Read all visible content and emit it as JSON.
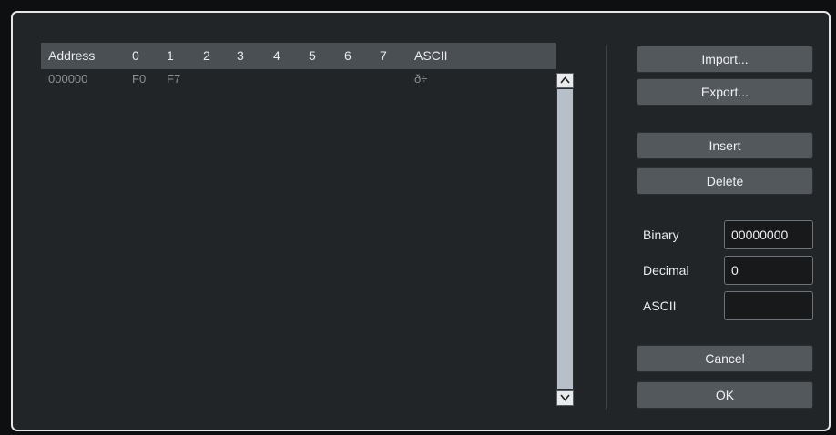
{
  "hex_table": {
    "columns": [
      "Address",
      "0",
      "1",
      "2",
      "3",
      "4",
      "5",
      "6",
      "7",
      "ASCII"
    ],
    "rows": [
      {
        "address": "000000",
        "bytes": [
          "F0",
          "F7",
          "",
          "",
          "",
          "",
          "",
          ""
        ],
        "ascii": "ð÷"
      }
    ]
  },
  "buttons": {
    "import": "Import...",
    "export": "Export...",
    "insert": "Insert",
    "delete": "Delete",
    "cancel": "Cancel",
    "ok": "OK"
  },
  "fields": {
    "binary": {
      "label": "Binary",
      "value": "00000000"
    },
    "decimal": {
      "label": "Decimal",
      "value": "0"
    },
    "ascii": {
      "label": "ASCII",
      "value": ""
    }
  },
  "colors": {
    "background": "#222528",
    "header": "#4a4f54",
    "button": "#53585d",
    "scroll_thumb": "#b7bfc9"
  }
}
